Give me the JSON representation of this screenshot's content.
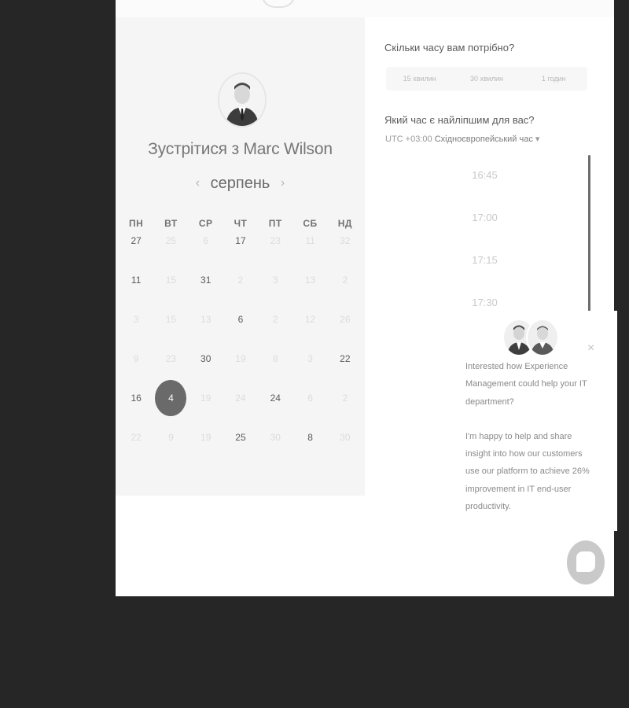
{
  "meeting": {
    "title": "Зустрітися з Marc Wilson",
    "month": "серпень",
    "prev_arrow": "‹",
    "next_arrow": "›"
  },
  "calendar": {
    "weekdays": [
      "ПН",
      "ВТ",
      "СР",
      "ЧТ",
      "ПТ",
      "СБ",
      "НД"
    ],
    "rows": [
      [
        {
          "d": "27",
          "a": true
        },
        {
          "d": "25",
          "a": false
        },
        {
          "d": "6",
          "a": false
        },
        {
          "d": "17",
          "a": true
        },
        {
          "d": "23",
          "a": false
        },
        {
          "d": "11",
          "a": false
        },
        {
          "d": "32",
          "a": false
        }
      ],
      [
        {
          "d": "11",
          "a": true
        },
        {
          "d": "15",
          "a": false
        },
        {
          "d": "31",
          "a": true
        },
        {
          "d": "2",
          "a": false
        },
        {
          "d": "3",
          "a": false
        },
        {
          "d": "13",
          "a": false
        },
        {
          "d": "2",
          "a": false
        }
      ],
      [
        {
          "d": "3",
          "a": false
        },
        {
          "d": "15",
          "a": false
        },
        {
          "d": "13",
          "a": false
        },
        {
          "d": "6",
          "a": true
        },
        {
          "d": "2",
          "a": false
        },
        {
          "d": "12",
          "a": false
        },
        {
          "d": "26",
          "a": false
        }
      ],
      [
        {
          "d": "9",
          "a": false
        },
        {
          "d": "23",
          "a": false
        },
        {
          "d": "30",
          "a": true
        },
        {
          "d": "19",
          "a": false
        },
        {
          "d": "8",
          "a": false
        },
        {
          "d": "3",
          "a": false
        },
        {
          "d": "22",
          "a": true
        }
      ],
      [
        {
          "d": "16",
          "a": true
        },
        {
          "d": "4",
          "a": true,
          "selected": true
        },
        {
          "d": "19",
          "a": false
        },
        {
          "d": "24",
          "a": false
        },
        {
          "d": "24",
          "a": true
        },
        {
          "d": "6",
          "a": false
        },
        {
          "d": "2",
          "a": false
        }
      ],
      [
        {
          "d": "22",
          "a": false
        },
        {
          "d": "9",
          "a": false
        },
        {
          "d": "19",
          "a": false
        },
        {
          "d": "25",
          "a": true
        },
        {
          "d": "30",
          "a": false
        },
        {
          "d": "8",
          "a": true
        },
        {
          "d": "30",
          "a": false
        }
      ]
    ]
  },
  "duration": {
    "label": "Скільки часу вам потрібно?",
    "options": [
      "15 хвилин",
      "30 хвилин",
      "1 годин"
    ]
  },
  "time": {
    "label": "Який час є найліпшим для вас?",
    "tz_offset": "UTC +03:00",
    "tz_name": "Східноєвропейський час",
    "tz_caret": "▾",
    "slots": [
      "16:45",
      "17:00",
      "17:15",
      "17:30"
    ]
  },
  "chat": {
    "close": "×",
    "message_1": "Interested how Experience Management could help your IT department?",
    "message_2": "I'm happy to help and share insight into how our customers use our platform to achieve 26% improvement in IT end-user productivity."
  },
  "colors": {
    "backdrop": "#262626",
    "selected_day": "#6a6a6a",
    "panel_left": "#f5f5f5"
  }
}
